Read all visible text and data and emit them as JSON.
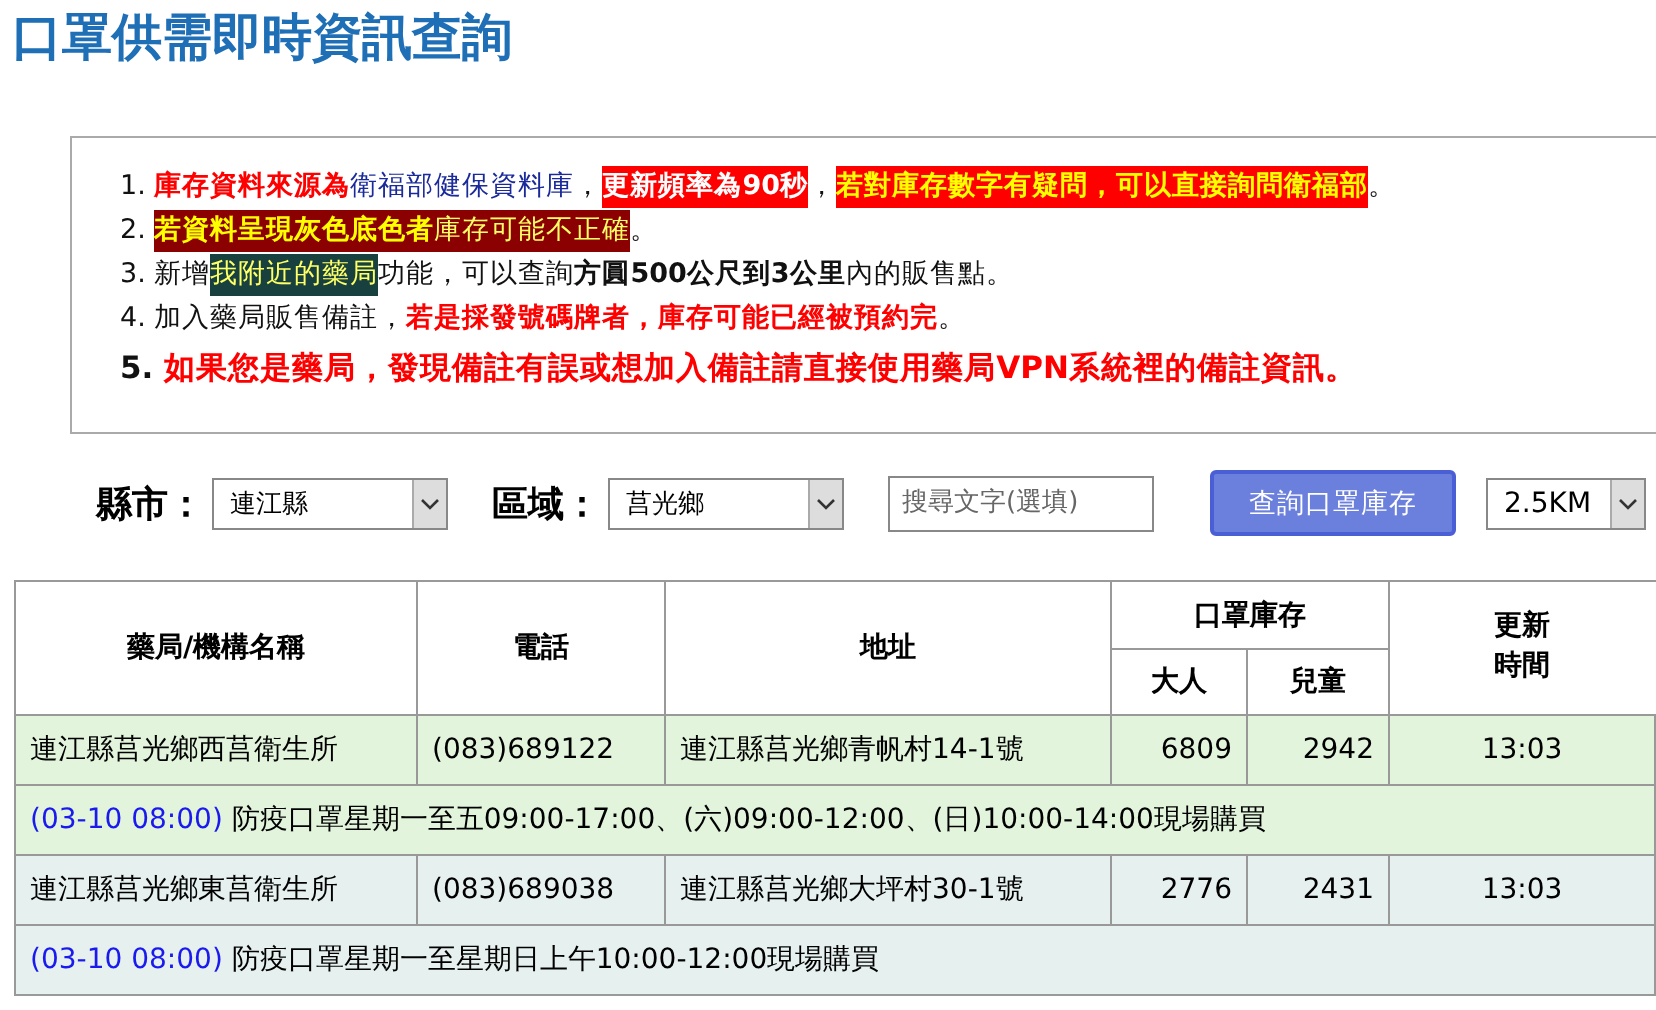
{
  "title": "口罩供需即時資訊查詢",
  "notices": [
    {
      "number": "1.",
      "segments": [
        {
          "kind": "red",
          "text": "庫存資料來源為"
        },
        {
          "kind": "blue",
          "text": "衛福部健保資料庫",
          "after": "，"
        },
        {
          "kind": "white-on-red",
          "text": "更新頻率為90秒",
          "after": "，"
        },
        {
          "kind": "yellow-on-red",
          "text": "若對庫存數字有疑問，可以直接詢問衛福部"
        },
        {
          "kind": "plain",
          "text": "。"
        }
      ]
    },
    {
      "number": "2.",
      "segments": [
        {
          "kind": "yellow-on-maroon",
          "text": "若資料呈現灰色底色者"
        },
        {
          "kind": "yellow-on-maroon-light",
          "text": "庫存可能不正確"
        },
        {
          "kind": "plain",
          "text": "。"
        }
      ]
    },
    {
      "number": "3.",
      "segments": [
        {
          "kind": "plain",
          "text": "新增"
        },
        {
          "kind": "yellow-on-teal",
          "text": "我附近的藥局"
        },
        {
          "kind": "plain",
          "text": "功能，可以查詢"
        },
        {
          "kind": "bold",
          "text": "方圓500公尺到3公里"
        },
        {
          "kind": "plain",
          "text": "內的販售點。"
        }
      ]
    },
    {
      "number": "4.",
      "segments": [
        {
          "kind": "plain",
          "text": "加入藥局販售備註，"
        },
        {
          "kind": "red",
          "text": "若是採發號碼牌者，庫存可能已經被預約完"
        },
        {
          "kind": "plain",
          "text": "。"
        }
      ]
    },
    {
      "number": "5.",
      "segments": [
        {
          "kind": "large-red",
          "text": "如果您是藥局，發現備註有誤或想加入備註請直接使用藥局VPN系統裡的備註資訊。"
        }
      ]
    }
  ],
  "filters": {
    "county_label": "縣市：",
    "county": "連江縣",
    "district_label": "區域：",
    "district": "莒光鄉",
    "search": {
      "placeholder": "搜尋文字(選填)"
    },
    "query_button": "查詢口罩庫存",
    "range": "2.5KM"
  },
  "table": {
    "columns": {
      "name": "藥局/機構名稱",
      "phone": "電話",
      "address": "地址",
      "stock": "口罩庫存",
      "adult": "大人",
      "child": "兒童",
      "updated": "更新時間"
    },
    "rows": [
      {
        "name": "連江縣莒光鄉西莒衛生所",
        "phone": "(083)689122",
        "address": "連江縣莒光鄉青帆村14-1號",
        "adult": "6809",
        "child": "2942",
        "updated": "13:03",
        "color": "#e2f5dc",
        "note_time": "(03-10 08:00)",
        "note": "防疫口罩星期一至五09:00-17:00、(六)09:00-12:00、(日)10:00-14:00現場購買"
      },
      {
        "name": "連江縣莒光鄉東莒衛生所",
        "phone": "(083)689038",
        "address": "連江縣莒光鄉大坪村30-1號",
        "adult": "2776",
        "child": "2431",
        "updated": "13:03",
        "color": "#e6f0ef",
        "note_time": "(03-10 08:00)",
        "note": "防疫口罩星期一至星期日上午10:00-12:00現場購買"
      }
    ]
  }
}
